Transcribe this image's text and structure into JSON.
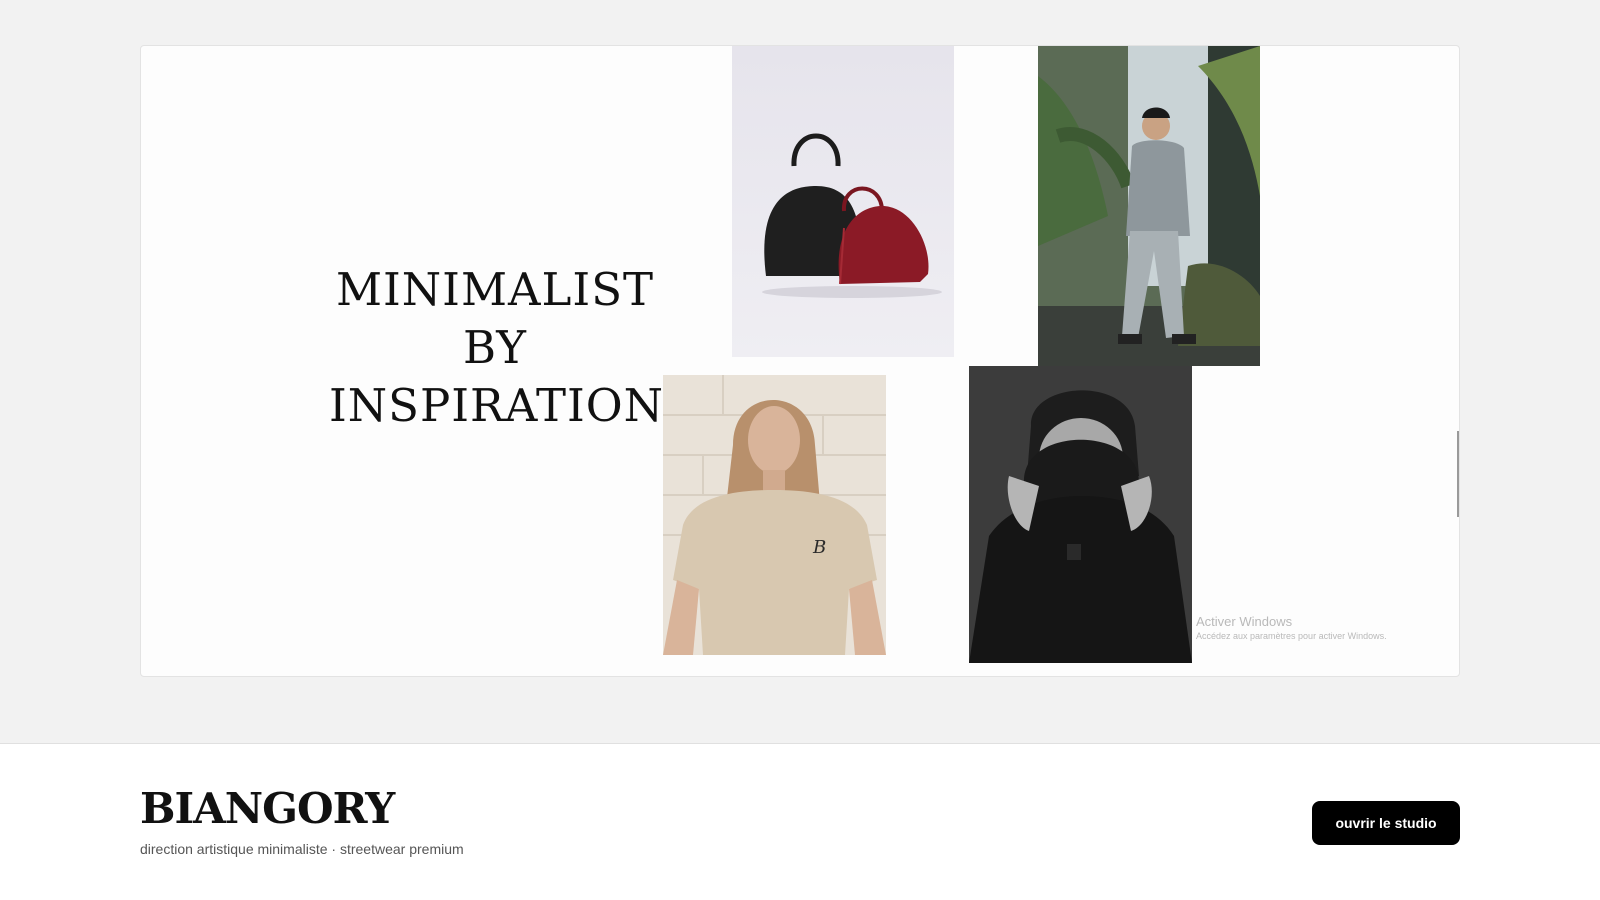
{
  "hero": {
    "headline": [
      "MINIMALIST",
      "BY",
      "INSPIRATION"
    ]
  },
  "photos": [
    {
      "icon": "handbags-photo"
    },
    {
      "icon": "child-streetwear-photo"
    },
    {
      "icon": "woman-tshirt-photo"
    },
    {
      "icon": "man-sweater-photo"
    }
  ],
  "tshirt_logo": "B",
  "watermark": {
    "title": "Activer Windows",
    "subtitle": "Accédez aux paramètres pour activer Windows."
  },
  "footer": {
    "brand": "BIANGORY",
    "tagline": "direction artistique minimaliste · streetwear premium",
    "cta_label": "ouvrir le studio"
  },
  "colors": {
    "background": "#f2f2f2",
    "card": "#fdfdfd",
    "cta_bg": "#000000",
    "cta_text": "#ffffff",
    "text": "#111111"
  }
}
